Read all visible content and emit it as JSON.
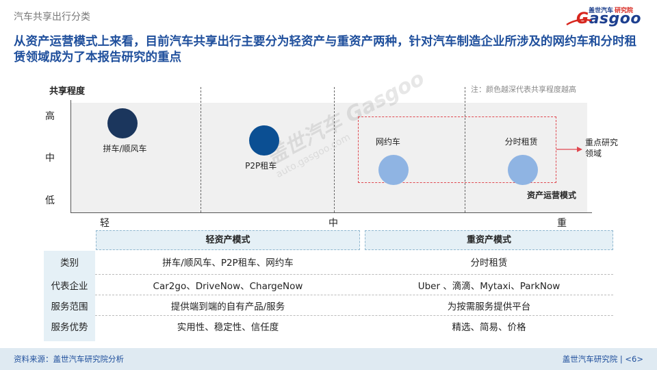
{
  "header": {
    "section": "汽车共享出行分类",
    "logo_cn": "盖世汽车",
    "logo_cn_red": "研究院",
    "logo_en_g": "G",
    "logo_en_rest": "asgoo"
  },
  "headline": "从资产运营模式上来看，目前汽车共享出行主要分为轻资产与重资产两种，针对汽车制造企业所涉及的网约车和分时租赁领域成为了本报告研究的重点",
  "chart_data": {
    "type": "scatter",
    "title": "",
    "ylabel": "共享程度",
    "xlabel": "资产运营模式",
    "y_ticks": [
      "高",
      "中",
      "低"
    ],
    "x_ticks": [
      "轻",
      "中",
      "重"
    ],
    "note": "注：颜色越深代表共享程度越高",
    "points": [
      {
        "label": "拼车/顺风车",
        "x": 0.2,
        "y": 1.0,
        "color": "#1b365d"
      },
      {
        "label": "P2P租车",
        "x": 0.75,
        "y": 0.7,
        "color": "#0b4f93"
      },
      {
        "label": "网约车",
        "x": 1.25,
        "y": 0.35,
        "color": "#8fb4e3"
      },
      {
        "label": "分时租赁",
        "x": 1.75,
        "y": 0.35,
        "color": "#8fb4e3"
      }
    ],
    "highlight": {
      "label_line1": "重点研究",
      "label_line2": "领域",
      "color": "#e0474f"
    }
  },
  "watermark": {
    "brand": "盖世汽车 Gasgoo",
    "url": "auto.gasgoo.com"
  },
  "table": {
    "headers": [
      "轻资产模式",
      "重资产模式"
    ],
    "rows": [
      {
        "label": "类别",
        "light": "拼车/顺风车、P2P租车、网约车",
        "heavy": "分时租赁"
      },
      {
        "label": "代表企业",
        "light": "Car2go、DriveNow、ChargeNow",
        "heavy": "Uber 、滴滴、Mytaxi、ParkNow"
      },
      {
        "label": "服务范围",
        "light": "提供端到端的自有产品/服务",
        "heavy": "为按需服务提供平台"
      },
      {
        "label": "服务优势",
        "light": "实用性、稳定性、信任度",
        "heavy": "精选、简易、价格"
      }
    ]
  },
  "footer": {
    "source": "资料来源：盖世汽车研究院分析",
    "org": "盖世汽车研究院 | <6>"
  }
}
